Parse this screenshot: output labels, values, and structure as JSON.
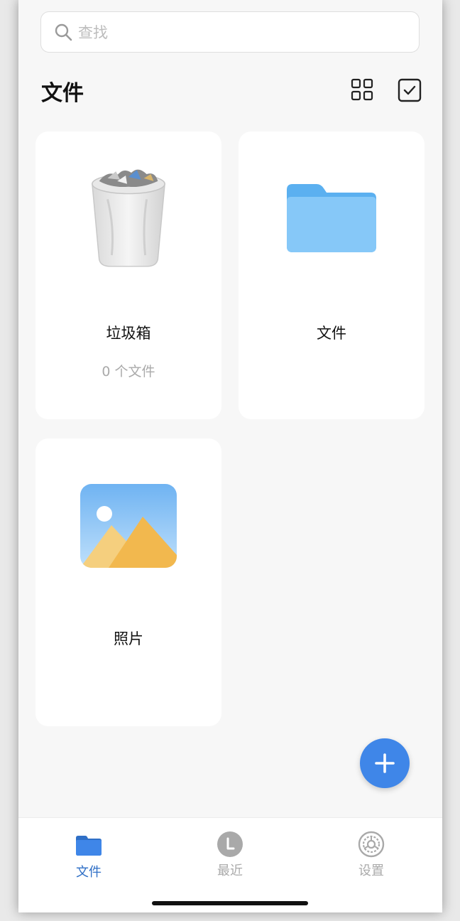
{
  "search": {
    "placeholder": "查找"
  },
  "header": {
    "title": "文件"
  },
  "folders": [
    {
      "name": "垃圾箱",
      "count": "0 个文件",
      "icon": "trash-icon"
    },
    {
      "name": "文件",
      "icon": "folder-icon"
    },
    {
      "name": "照片",
      "icon": "photos-icon"
    }
  ],
  "tabs": [
    {
      "label": "文件",
      "icon": "folder-icon",
      "active": true
    },
    {
      "label": "最近",
      "icon": "clock-icon",
      "active": false
    },
    {
      "label": "设置",
      "icon": "gear-icon",
      "active": false
    }
  ],
  "colors": {
    "accent": "#3f86e8",
    "tab_active": "#2f6fc6",
    "tab_inactive": "#aaaaaa"
  }
}
